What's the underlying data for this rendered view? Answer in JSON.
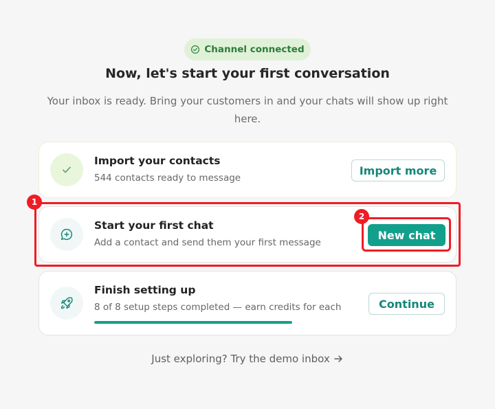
{
  "status_badge": {
    "label": "Channel connected",
    "icon": "check-circle-icon",
    "color": "#2f7a3c"
  },
  "heading": "Now, let's start your first conversation",
  "subheading": "Your inbox is ready. Bring your customers in and your chats will show up right here.",
  "cards": [
    {
      "icon": "check-icon",
      "title": "Import your contacts",
      "subtitle": "544 contacts ready to message",
      "button": "Import more"
    },
    {
      "icon": "chat-plus-icon",
      "title": "Start your first chat",
      "subtitle": "Add a contact and send them your first message",
      "button": "New chat"
    },
    {
      "icon": "rocket-icon",
      "title": "Finish setting up",
      "subtitle": "8 of 8 setup steps completed — earn credits for each",
      "button": "Continue",
      "progress": 1.0
    }
  ],
  "footer_link": {
    "label": "Just exploring? Try the demo inbox",
    "icon": "arrow-right-icon"
  },
  "annotations": [
    "1",
    "2"
  ],
  "colors": {
    "accent": "#12a08c",
    "highlight": "#ef1c24",
    "background": "#f6f6f6"
  }
}
